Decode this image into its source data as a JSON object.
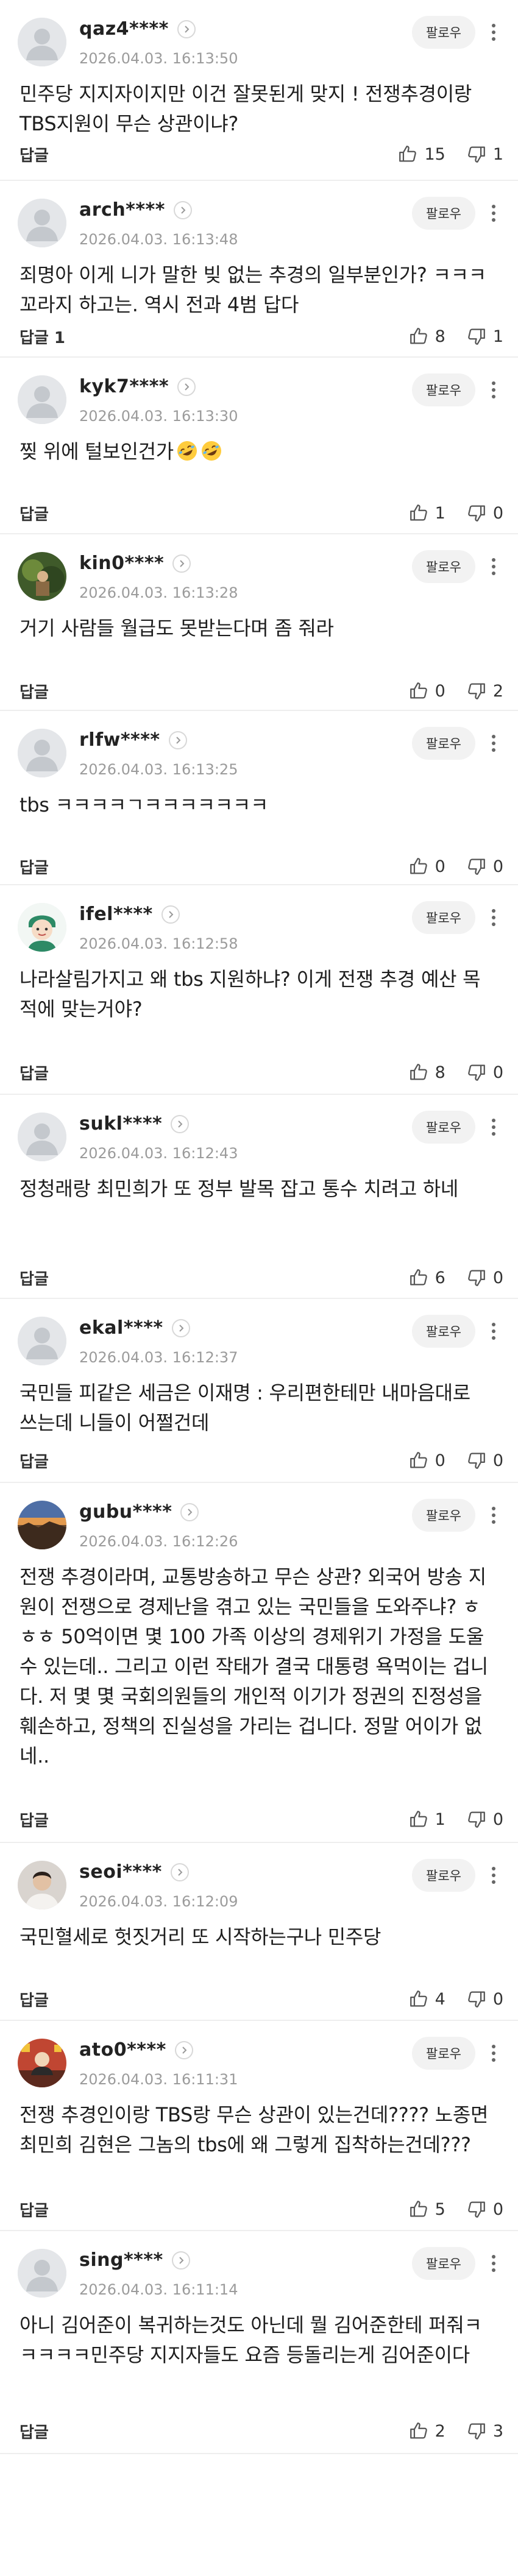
{
  "labels": {
    "follow": "팔로우",
    "reply": "답글"
  },
  "comments": [
    {
      "nick": "qaz4****",
      "time": "2026.04.03. 16:13:50",
      "text": "민주당 지지자이지만 이건 잘못된게 맞지 ! 전쟁추경이랑 TBS지원이 무슨 상관이냐?",
      "reply": "답글",
      "up": "15",
      "down": "1",
      "avatar": "default"
    },
    {
      "nick": "arch****",
      "time": "2026.04.03. 16:13:48",
      "text": "죄명아 이게 니가 말한 빚 없는 추경의 일부분인가? ㅋㅋㅋ 꼬라지 하고는. 역시 전과 4범 답다",
      "reply": "답글 1",
      "up": "8",
      "down": "1",
      "avatar": "default"
    },
    {
      "nick": "kyk7****",
      "time": "2026.04.03. 16:13:30",
      "text": "찢 위에 털보인건가",
      "emoji": "rofl",
      "reply": "답글",
      "up": "1",
      "down": "0",
      "avatar": "default"
    },
    {
      "nick": "kin0****",
      "time": "2026.04.03. 16:13:28",
      "text": "거기 사람들 월급도 못받는다며 좀 줘라",
      "reply": "답글",
      "up": "0",
      "down": "2",
      "avatar": "photo-green"
    },
    {
      "nick": "rlfw****",
      "time": "2026.04.03. 16:13:25",
      "text": "tbs ㅋㅋㅋㅋㄱㅋㅋㅋㅋㅋㅋㅋ",
      "reply": "답글",
      "up": "0",
      "down": "0",
      "avatar": "default"
    },
    {
      "nick": "ifel****",
      "time": "2026.04.03. 16:12:58",
      "text": "나라살림가지고 왜 tbs 지원하냐? 이게 전쟁 추경 예산 목적에 맞는거야?",
      "reply": "답글",
      "up": "8",
      "down": "0",
      "avatar": "cartoon"
    },
    {
      "nick": "sukl****",
      "time": "2026.04.03. 16:12:43",
      "text": "정청래랑 최민희가 또 정부 발목 잡고 통수 치려고 하네",
      "reply": "답글",
      "up": "6",
      "down": "0",
      "avatar": "default"
    },
    {
      "nick": "ekal****",
      "time": "2026.04.03. 16:12:37",
      "text": "국민들 피같은 세금은 이재명 : 우리편한테만 내마음대로 쓰는데 니들이 어쩔건데",
      "reply": "답글",
      "up": "0",
      "down": "0",
      "avatar": "default"
    },
    {
      "nick": "gubu****",
      "time": "2026.04.03. 16:12:26",
      "text": "전쟁 추경이라며, 교통방송하고 무슨 상관? 외국어 방송 지원이 전쟁으로 경제난을 겪고 있는 국민들을 도와주냐? ㅎㅎㅎ 50억이면 몇 100 가족 이상의 경제위기 가정을 도울 수 있는데.. 그리고 이런 작태가 결국 대통령 욕먹이는 겁니다. 저 몇 몇 국회의원들의 개인적 이기가 정권의 진정성을 훼손하고, 정책의 진실성을 가리는 겁니다. 정말 어이가 없네..",
      "reply": "답글",
      "up": "1",
      "down": "0",
      "avatar": "photo-sunset"
    },
    {
      "nick": "seoi****",
      "time": "2026.04.03. 16:12:09",
      "text": "국민혈세로 헛짓거리 또 시작하는구나 민주당",
      "reply": "답글",
      "up": "4",
      "down": "0",
      "avatar": "photo-person"
    },
    {
      "nick": "ato0****",
      "time": "2026.04.03. 16:11:31",
      "text": "전쟁 추경인이랑 TBS랑 무슨 상관이 있는건데???? 노종면 최민희 김현은 그놈의 tbs에 왜 그렇게 집착하는건데???",
      "reply": "답글",
      "up": "5",
      "down": "0",
      "avatar": "photo-red"
    },
    {
      "nick": "sing****",
      "time": "2026.04.03. 16:11:14",
      "text": "아니 김어준이 복귀하는것도 아닌데 뭘 김어준한테 퍼줘ㅋㅋㅋㅋㅋ민주당 지지자들도 요즘 등돌리는게 김어준이다",
      "reply": "답글",
      "up": "2",
      "down": "3",
      "avatar": "default"
    }
  ]
}
